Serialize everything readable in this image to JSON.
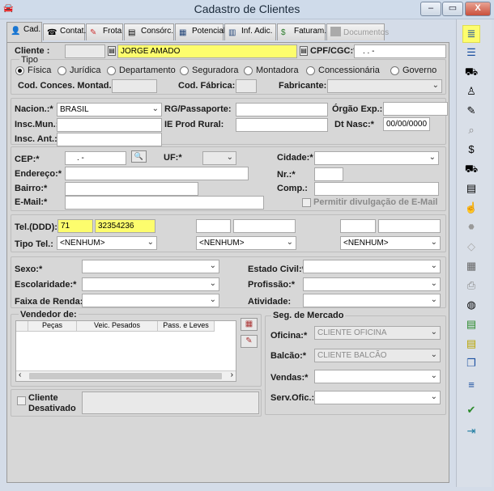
{
  "window": {
    "title": "Cadastro de Clientes",
    "minimize": "–",
    "maximize": "▭",
    "close": "X"
  },
  "tabs": [
    {
      "label": "Cad."
    },
    {
      "label": "Contat."
    },
    {
      "label": "Frota"
    },
    {
      "label": "Consórc."
    },
    {
      "label": "Potencial"
    },
    {
      "label": "Inf. Adic."
    },
    {
      "label": "Faturam."
    },
    {
      "label": "Documentos"
    }
  ],
  "cliente": {
    "label": "Cliente :",
    "code": "",
    "name": "JORGE AMADO",
    "cpf_label": "CPF/CGC:*",
    "cpf_value": ". . -"
  },
  "tipo": {
    "legend": "Tipo",
    "options": [
      "Física",
      "Jurídica",
      "Departamento",
      "Seguradora",
      "Montadora",
      "Concessionária",
      "Governo"
    ],
    "selected": "Física"
  },
  "concess": {
    "label": "Cod. Conces. Montad.:",
    "fabrica_label": "Cod. Fábrica:",
    "fabricante_label": "Fabricante:"
  },
  "docs": {
    "nacion_label": "Nacion.:*",
    "nacion_value": "BRASIL",
    "rg_label": "RG/Passaporte:",
    "orgao_label": "Órgão Exp.:",
    "insc_mun_label": "Insc.Mun.:",
    "ie_label": "IE Prod Rural:",
    "dtnasc_label": "Dt Nasc:*",
    "dtnasc_value": "00/00/0000",
    "insc_ant_label": "Insc. Ant.:"
  },
  "endereco": {
    "cep_label": "CEP:*",
    "cep_value": ". -",
    "uf_label": "UF:*",
    "cidade_label": "Cidade:*",
    "endereco_label": "Endereço:*",
    "nr_label": "Nr.:*",
    "bairro_label": "Bairro:*",
    "comp_label": "Comp.:",
    "email_label": "E-Mail:*",
    "permitir_label": "Permitir divulgação de E-Mail"
  },
  "telefone": {
    "tel_label": "Tel.(DDD):",
    "ddd": "71",
    "numero": "32354236",
    "tipo_label": "Tipo Tel.:",
    "tipo1": "<NENHUM>",
    "tipo2": "<NENHUM>",
    "tipo3": "<NENHUM>"
  },
  "perfil": {
    "sexo_label": "Sexo:*",
    "escolaridade_label": "Escolaridade:*",
    "renda_label": "Faixa de Renda:",
    "civil_label": "Estado Civil:*",
    "profissao_label": "Profissão:*",
    "atividade_label": "Atividade:"
  },
  "vendedor": {
    "legend": "Vendedor de:",
    "columns": [
      "Peças",
      "Veic. Pesados",
      "Pass. e Leves"
    ]
  },
  "mercado": {
    "legend": "Seg. de Mercado",
    "oficina_label": "Oficina:*",
    "oficina_value": "CLIENTE OFICINA",
    "balcao_label": "Balcão:*",
    "balcao_value": "CLIENTE BALCÃO",
    "vendas_label": "Vendas:*",
    "servofic_label": "Serv.Ofic.:"
  },
  "status": {
    "desativado_label": "Cliente Desativado"
  },
  "toolbar": {
    "icons": [
      "list-add-icon",
      "list-icon",
      "vehicle-icon",
      "person-icon",
      "edit-icon",
      "search-doc-icon",
      "moneybag-icon",
      "car-icon",
      "document-icon",
      "hand-icon",
      "stop-icon",
      "gray-icon",
      "calendar-icon",
      "printer-icon",
      "globe-icon",
      "green-doc-icon",
      "yellow-doc-icon",
      "copy-icon",
      "align-icon",
      "check-icon",
      "exit-icon"
    ]
  }
}
